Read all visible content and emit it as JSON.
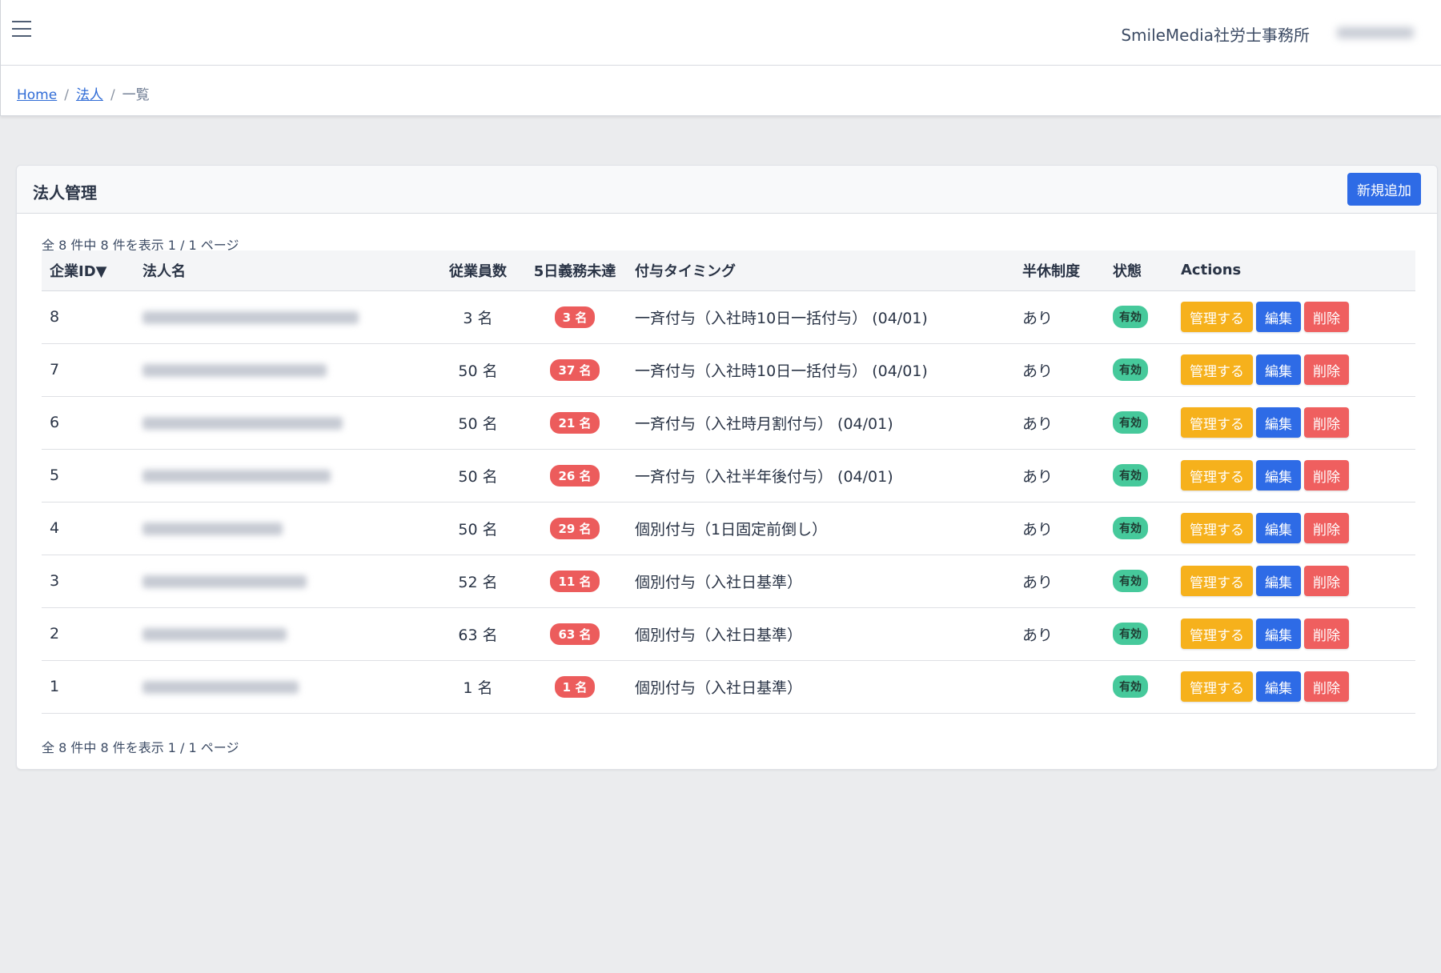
{
  "header": {
    "office_name": "SmileMedia社労士事務所"
  },
  "breadcrumb": {
    "home": "Home",
    "corp": "法人",
    "current": "一覧",
    "sep": "/"
  },
  "card": {
    "title": "法人管理",
    "add_button": "新規追加",
    "summary_top": "全 8 件中 8 件を表示 1 / 1 ページ",
    "summary_bottom": "全 8 件中 8 件を表示 1 / 1 ページ"
  },
  "table": {
    "columns": [
      "企業ID▼",
      "法人名",
      "従業員数",
      "5日義務未達",
      "付与タイミング",
      "半休制度",
      "状態",
      "Actions"
    ],
    "action_labels": {
      "manage": "管理する",
      "edit": "編集",
      "delete": "削除"
    },
    "rows": [
      {
        "id": "8",
        "employees": "3 名",
        "unmet": "3 名",
        "timing": "一斉付与（入社時10日一括付与） (04/01)",
        "half_day": "あり",
        "status": "有効"
      },
      {
        "id": "7",
        "employees": "50 名",
        "unmet": "37 名",
        "timing": "一斉付与（入社時10日一括付与） (04/01)",
        "half_day": "あり",
        "status": "有効"
      },
      {
        "id": "6",
        "employees": "50 名",
        "unmet": "21 名",
        "timing": "一斉付与（入社時月割付与） (04/01)",
        "half_day": "あり",
        "status": "有効"
      },
      {
        "id": "5",
        "employees": "50 名",
        "unmet": "26 名",
        "timing": "一斉付与（入社半年後付与） (04/01)",
        "half_day": "あり",
        "status": "有効"
      },
      {
        "id": "4",
        "employees": "50 名",
        "unmet": "29 名",
        "timing": "個別付与（1日固定前倒し）",
        "half_day": "あり",
        "status": "有効"
      },
      {
        "id": "3",
        "employees": "52 名",
        "unmet": "11 名",
        "timing": "個別付与（入社日基準）",
        "half_day": "あり",
        "status": "有効"
      },
      {
        "id": "2",
        "employees": "63 名",
        "unmet": "63 名",
        "timing": "個別付与（入社日基準）",
        "half_day": "あり",
        "status": "有効"
      },
      {
        "id": "1",
        "employees": "1 名",
        "unmet": "1 名",
        "timing": "個別付与（入社日基準）",
        "half_day": "",
        "status": "有効"
      }
    ]
  },
  "colors": {
    "primary": "#2e6be6",
    "warning": "#f6b11c",
    "danger": "#ef5f5f",
    "success": "#46c99b"
  }
}
